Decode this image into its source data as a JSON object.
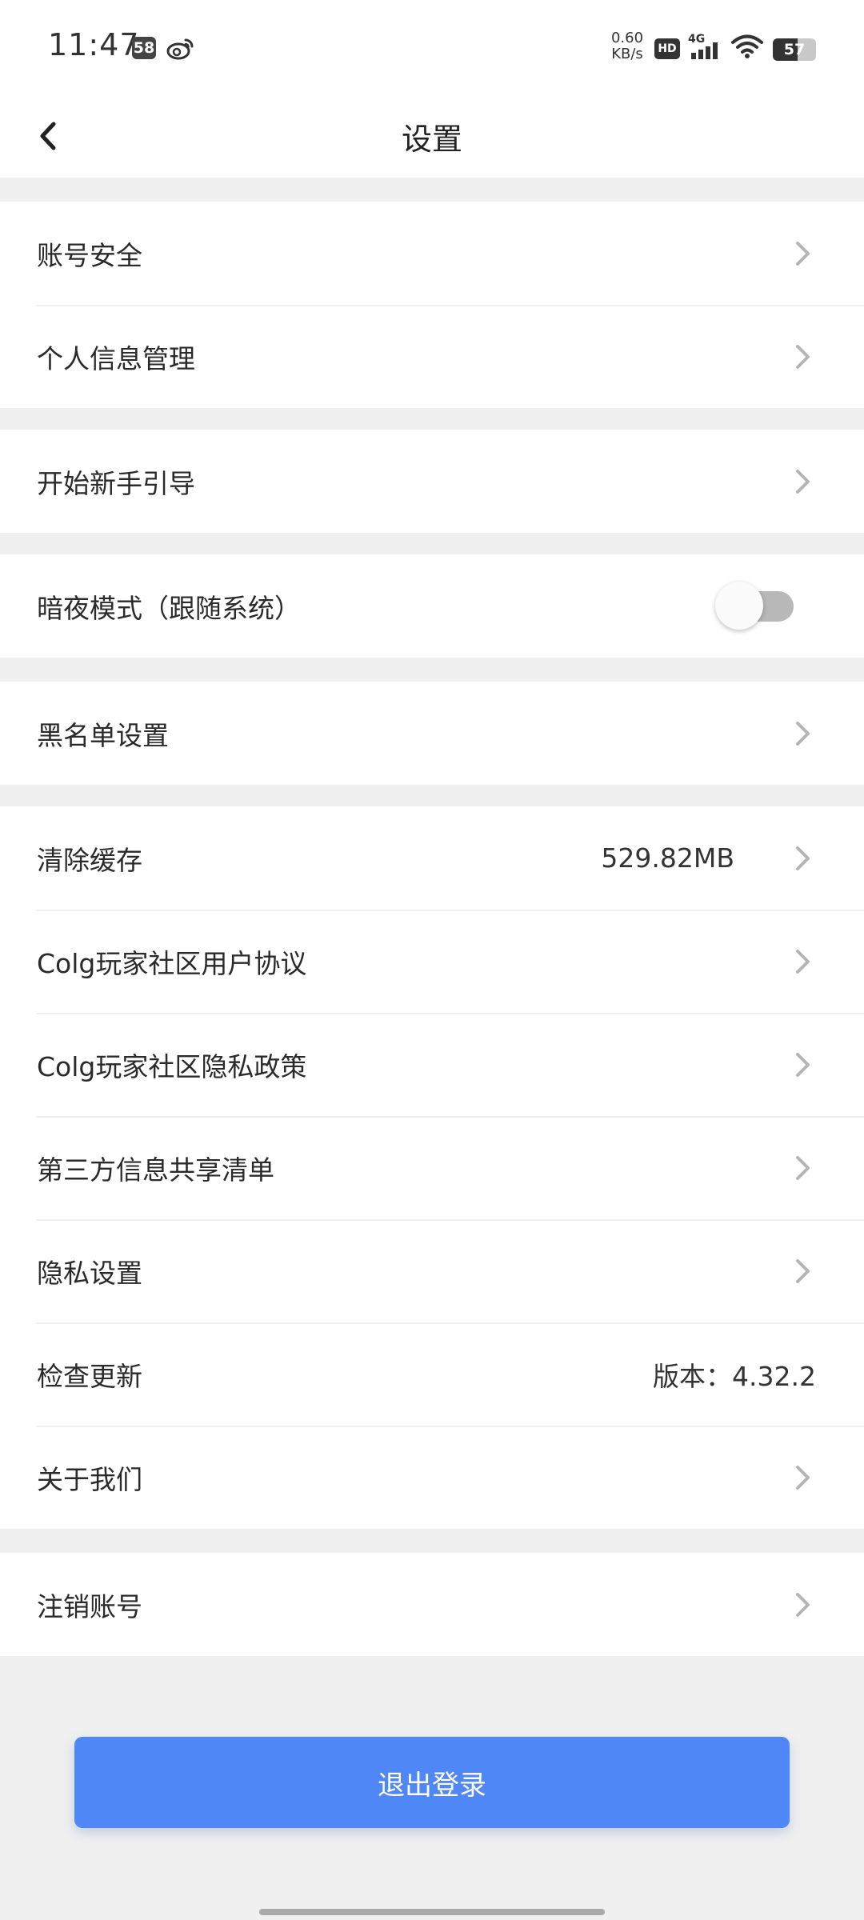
{
  "status_bar": {
    "time": "11:47",
    "notification_badge": "58",
    "network_speed_value": "0.60",
    "network_speed_unit": "KB/s",
    "hd_label": "HD",
    "signal_label": "4G",
    "battery_level": "57",
    "icons": [
      "weibo-icon",
      "hd-icon",
      "signal-icon",
      "wifi-icon",
      "battery-icon"
    ]
  },
  "header": {
    "title": "设置",
    "back_icon": "back-arrow-icon"
  },
  "groups": [
    {
      "rows": [
        {
          "label": "账号安全"
        },
        {
          "label": "个人信息管理"
        }
      ]
    },
    {
      "rows": [
        {
          "label": "开始新手引导"
        }
      ]
    },
    {
      "rows": [
        {
          "label": "暗夜模式（跟随系统）",
          "toggle_on": false
        }
      ]
    },
    {
      "rows": [
        {
          "label": "黑名单设置"
        }
      ]
    },
    {
      "rows": [
        {
          "label": "清除缓存",
          "value": "529.82MB"
        },
        {
          "label": "Colg玩家社区用户协议"
        },
        {
          "label": "Colg玩家社区隐私政策"
        },
        {
          "label": "第三方信息共享清单"
        },
        {
          "label": "隐私设置"
        },
        {
          "label": "检查更新",
          "value": "版本：4.32.2"
        },
        {
          "label": "关于我们"
        }
      ]
    },
    {
      "rows": [
        {
          "label": "注销账号"
        }
      ]
    }
  ],
  "logout_label": "退出登录",
  "colors": {
    "accent": "#4f88f6",
    "background": "#f0f0f0",
    "toggle_off": "#b8b8b8"
  }
}
